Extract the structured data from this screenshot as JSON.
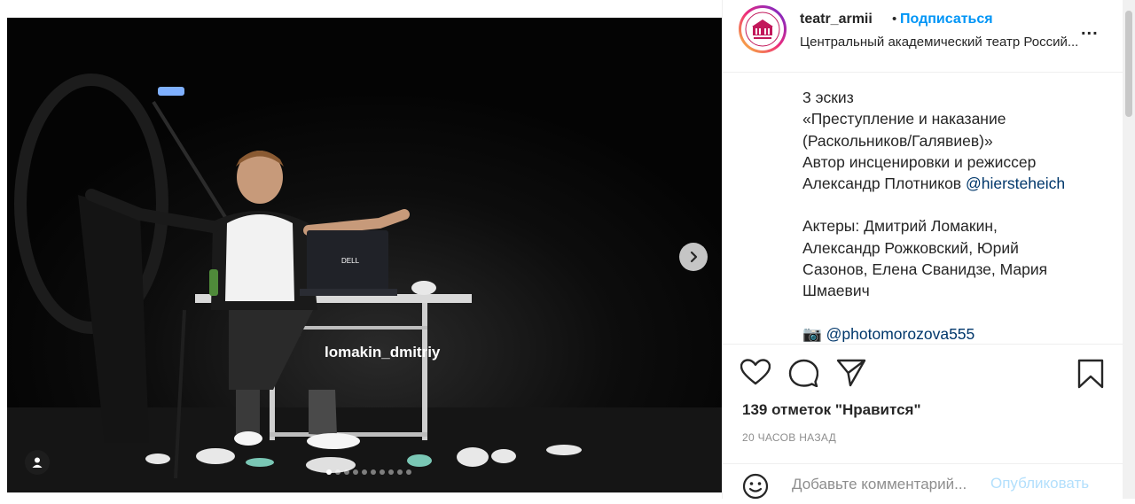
{
  "post": {
    "user_tag": "lomakin_dmitriy",
    "laptop_brand": "DELL"
  },
  "header": {
    "username": "teatr_armii",
    "separator": "•",
    "follow_label": "Подписаться",
    "subtitle": "Центральный академический театр Россий...",
    "more_label": "..."
  },
  "caption": {
    "lines": [
      "3 эскиз",
      "«Преступление и наказание",
      "(Раскольников/Галявиев)»",
      "Автор инсценировки и режиссер",
      "Александр Плотников"
    ],
    "mention_1": "@hiersteheich",
    "actors": [
      "Актеры: Дмитрий Ломакин,",
      "Александр Рожковский, Юрий",
      "Сазонов, Елена Сванидзе, Мария",
      "Шмаевич"
    ],
    "camera_emoji": "📷",
    "mention_2": "@photomorozova555"
  },
  "actions": {
    "likes_text": "139 отметок \"Нравится\"",
    "time_ago": "20 ЧАСОВ НАЗАД"
  },
  "comment": {
    "placeholder": "Добавьте комментарий...",
    "publish_label": "Опубликовать"
  },
  "colors": {
    "accent": "#0095f6",
    "mention": "#00376b",
    "publish_disabled": "#b2dffc",
    "muted": "#8e8e8e"
  },
  "icons": [
    "heart-icon",
    "comment-icon",
    "share-icon",
    "bookmark-icon",
    "emoji-icon",
    "chevron-right-icon",
    "user-tag-icon",
    "more-icon",
    "camera-emoji"
  ]
}
